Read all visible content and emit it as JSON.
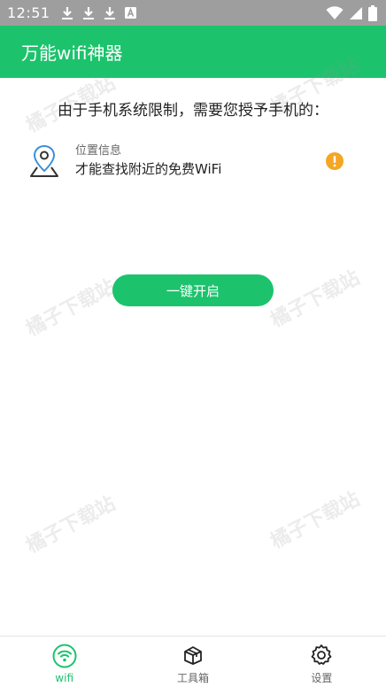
{
  "status_bar": {
    "time": "12:51",
    "icons_left": [
      "download-icon",
      "download-icon",
      "download-icon",
      "a-badge-icon"
    ],
    "icons_right": [
      "wifi-signal-icon",
      "cell-signal-icon",
      "battery-icon"
    ]
  },
  "app_bar": {
    "title": "万能wifi神器"
  },
  "main": {
    "intro": "由于手机系统限制，需要您授予手机的：",
    "permission": {
      "icon": "location-pin-icon",
      "title": "位置信息",
      "description": "才能查找附近的免费WiFi",
      "status_icon": "warning-icon"
    },
    "enable_button": "一键开启"
  },
  "watermark": "橘子下载站",
  "bottom_nav": [
    {
      "label": "wifi",
      "icon": "wifi-icon",
      "active": true
    },
    {
      "label": "工具箱",
      "icon": "toolbox-icon",
      "active": false
    },
    {
      "label": "设置",
      "icon": "gear-icon",
      "active": false
    }
  ],
  "colors": {
    "primary": "#1cc36c",
    "status_bar": "#9e9e9e",
    "warning": "#f5a623",
    "location_blue": "#3b8fd8"
  }
}
